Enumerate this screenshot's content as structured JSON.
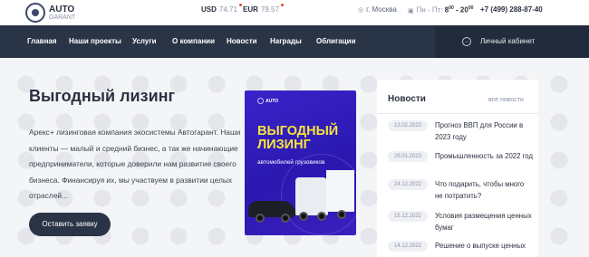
{
  "header": {
    "logo": {
      "name": "AUTO",
      "sub": "GARANT"
    },
    "rates": [
      {
        "code": "USD",
        "value": "74.71"
      },
      {
        "code": "EUR",
        "value": "79.57"
      }
    ],
    "city": "г. Москва",
    "hours": {
      "days": "Пн - Пт:",
      "from": "8",
      "from_sup": "00",
      "to": "20",
      "to_sup": "00"
    },
    "phone": "+7 (499) 288-87-40"
  },
  "nav": {
    "items": [
      "Главная",
      "Наши проекты",
      "Услуги",
      "О компании",
      "Новости",
      "Награды",
      "Облигации"
    ],
    "cabinet": "Личный кабинет"
  },
  "hero": {
    "title": "Выгодный лизинг",
    "text": "Арекс+ лизинговая компания экосистемы Автогарант. Наши клиенты — малый и средний бизнес, а так же начинающие предприниматели, которые доверили нам развитие своего бизнеса. Финансируя их, мы участвуем в развитии целых отраслей...",
    "cta": "Оставить заявку"
  },
  "banner": {
    "logo": "AUTO",
    "title": "ВЫГОДНЫЙ ЛИЗИНГ",
    "subtitle": "автомобилей грузовиков"
  },
  "news": {
    "title": "Новости",
    "all": "все новости",
    "items": [
      {
        "date": "13.02.2023",
        "text": "Прогноз ВВП для России в 2023 году"
      },
      {
        "date": "25.01.2023",
        "text": "Промышленность за 2022 год"
      },
      {
        "date": "24.12.2022",
        "text": "Что подарить, чтобы много не потратить?"
      },
      {
        "date": "15.12.2022",
        "text": "Условия размещения ценных бумаг"
      },
      {
        "date": "14.12.2022",
        "text": "Решение о выпуске ценных"
      }
    ]
  },
  "colors": {
    "nav_bg": "#2a3447",
    "accent_yellow": "#f7e43b",
    "banner_bg": "#3a23c9",
    "rate_dot": "#e8462b"
  }
}
